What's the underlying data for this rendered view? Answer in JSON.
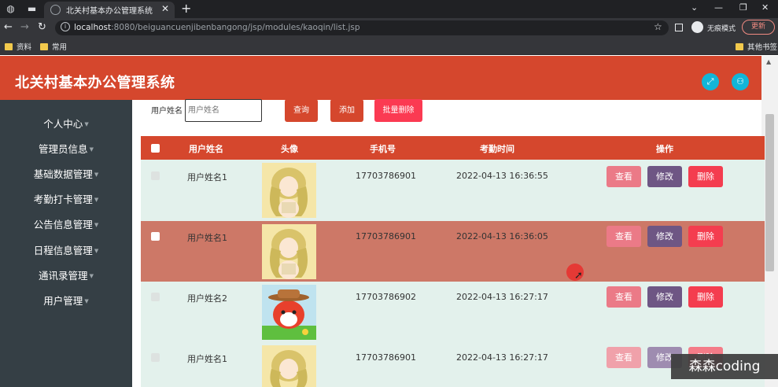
{
  "browser": {
    "tab_title": "北关村基本办公管理系统",
    "url_host": "localhost",
    "url_rest": ":8080/beiguancuenjibenbangong/jsp/modules/kaoqin/list.jsp",
    "incognito_label": "无痕模式",
    "update_label": "更新",
    "bookmarks": [
      "资料",
      "常用"
    ],
    "other_bookmarks": "其他书签"
  },
  "header": {
    "title": "北关村基本办公管理系统",
    "accent_color": "#d5472d",
    "icon_color": "#12b5d8"
  },
  "sidebar": {
    "items": [
      {
        "label": "个人中心"
      },
      {
        "label": "管理员信息"
      },
      {
        "label": "基础数据管理"
      },
      {
        "label": "考勤打卡管理"
      },
      {
        "label": "公告信息管理"
      },
      {
        "label": "日程信息管理"
      },
      {
        "label": "通讯录管理"
      },
      {
        "label": "用户管理"
      }
    ]
  },
  "search": {
    "label": "用户姓名",
    "placeholder": "用户姓名",
    "query_button": "查询",
    "add_button": "添加",
    "batch_delete_button": "批量删除"
  },
  "table": {
    "headers": [
      "用户姓名",
      "头像",
      "手机号",
      "考勤时间",
      "操作"
    ],
    "rows": [
      {
        "name": "用户姓名1",
        "phone": "17703786901",
        "time": "2022-04-13 16:36:55",
        "avatar": "girl-avatar"
      },
      {
        "name": "用户姓名1",
        "phone": "17703786901",
        "time": "2022-04-13 16:36:05",
        "avatar": "girl-avatar"
      },
      {
        "name": "用户姓名2",
        "phone": "17703786902",
        "time": "2022-04-13 16:27:17",
        "avatar": "fox-avatar"
      },
      {
        "name": "用户姓名1",
        "phone": "17703786901",
        "time": "2022-04-13 16:27:17",
        "avatar": "girl-avatar"
      }
    ],
    "view_label": "查看",
    "edit_label": "修改",
    "delete_label": "删除"
  },
  "watermark": "森森coding"
}
